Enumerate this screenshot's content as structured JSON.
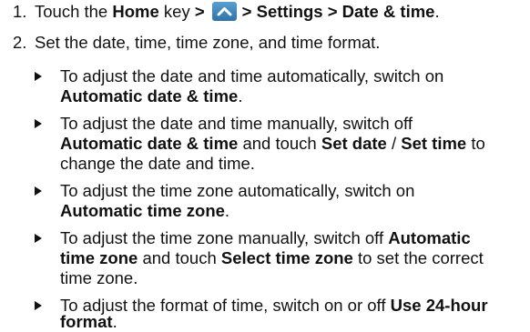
{
  "steps": [
    {
      "number": "1.",
      "parts": {
        "a": "Touch the ",
        "b": "Home",
        "c": " key ",
        "d": ">",
        "e": "> Settings > Date & time",
        "f": "."
      }
    },
    {
      "number": "2.",
      "text": "Set the date, time, time zone, and time format."
    }
  ],
  "bullets": [
    {
      "l1": "To adjust the date and time automatically, switch on",
      "l2_bold": "Automatic date & time",
      "l2_end": "."
    },
    {
      "l1": "To adjust the date and time manually, switch off",
      "l2_b1": "Automatic date & time",
      "l2_t1": " and touch ",
      "l2_b2": "Set date",
      "l2_t2": " / ",
      "l2_b3": "Set time",
      "l2_t3": " to",
      "l3": "change the date and time."
    },
    {
      "l1": "To adjust the time zone automatically, switch on",
      "l2_bold": "Automatic time zone",
      "l2_end": "."
    },
    {
      "l1_text": "To adjust the time zone manually, switch off ",
      "l1_bold": "Automatic",
      "l2_bold1": "time zone",
      "l2_text1": " and touch ",
      "l2_bold2": "Select time zone",
      "l2_text2": " to set the correct",
      "l3": "time zone."
    },
    {
      "l1_text": "To adjust the format of time, switch on or off ",
      "l1_bold": "Use 24-hour",
      "l2_bold": "format",
      "l2_end": "."
    }
  ],
  "icons": {
    "home_icon": "up-chevron-icon",
    "home_icon_color": "#3a82bc"
  }
}
